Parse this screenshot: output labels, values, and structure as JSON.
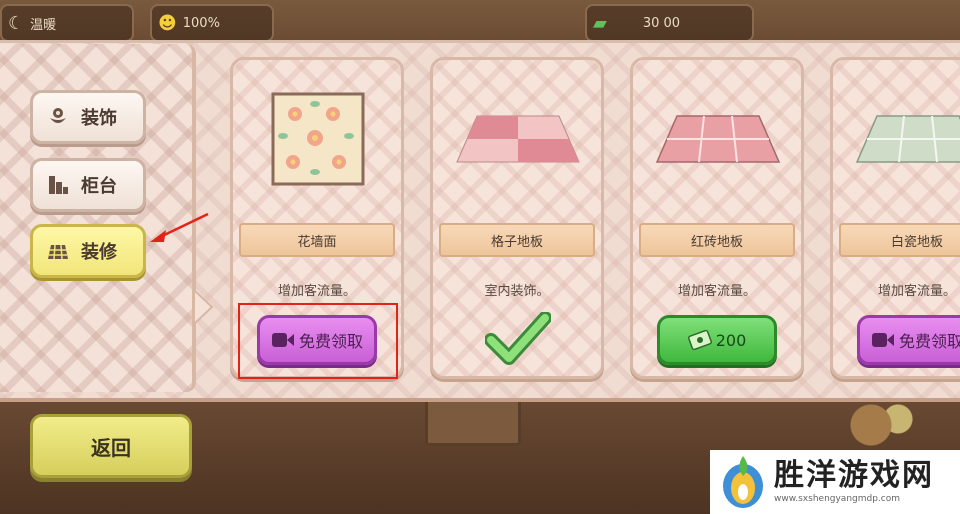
{
  "hud": {
    "chip1_text": "温暖",
    "chip2_text": "100%",
    "chip3_text": "30 00"
  },
  "sidebar": {
    "items": [
      {
        "label": "装饰",
        "icon": "flower-icon",
        "active": false
      },
      {
        "label": "柜台",
        "icon": "counter-icon",
        "active": false
      },
      {
        "label": "装修",
        "icon": "tiles-icon",
        "active": true
      }
    ]
  },
  "cards": [
    {
      "name": "花墙面",
      "desc": "增加客流量。",
      "action": "free",
      "button_label": "免费领取",
      "thumb": "flower-wall"
    },
    {
      "name": "格子地板",
      "desc": "室内装饰。",
      "action": "owned",
      "button_label": "",
      "thumb": "checker-floor"
    },
    {
      "name": "红砖地板",
      "desc": "增加客流量。",
      "action": "buy",
      "button_label": "200",
      "thumb": "red-brick-floor"
    },
    {
      "name": "白瓷地板",
      "desc": "增加客流量。",
      "action": "free",
      "button_label": "免费领取",
      "thumb": "white-tile-floor"
    }
  ],
  "back_button": {
    "label": "返回"
  },
  "watermark": {
    "title": "胜洋游戏网",
    "url": "www.sxshengyangmdp.com"
  },
  "colors": {
    "active_tab": "#f1e67a",
    "purple_button": "#c85fd6",
    "green_button": "#3fb83c",
    "highlight": "#e2231a"
  }
}
